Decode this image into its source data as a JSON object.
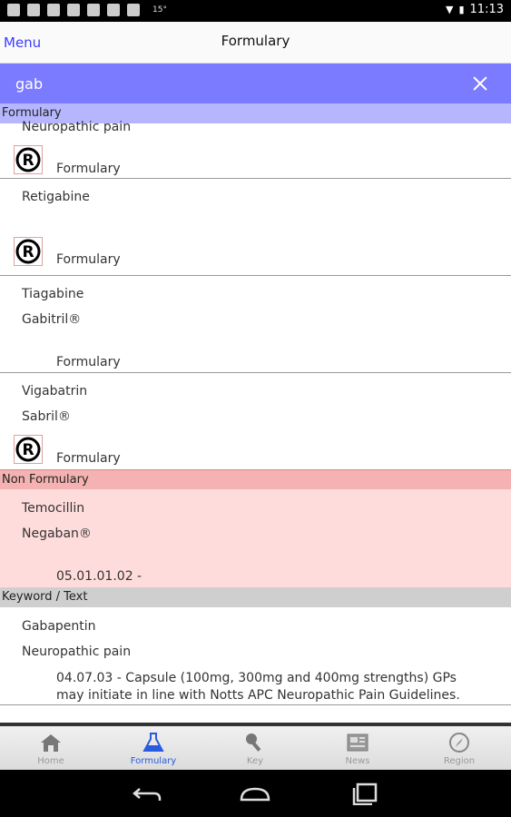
{
  "status_bar": {
    "temperature": "15°",
    "time": "11:13"
  },
  "action_bar": {
    "menu_label": "Menu",
    "title": "Formulary"
  },
  "search": {
    "value": "gab"
  },
  "sections": {
    "formulary": "Formulary",
    "non_formulary": "Non Formulary",
    "keyword": "Keyword / Text"
  },
  "items": [
    {
      "line2": "Neuropathic pain",
      "status": "Formulary"
    },
    {
      "name": "Retigabine",
      "status": "Formulary"
    },
    {
      "name": "Tiagabine",
      "brand": "Gabitril®",
      "status": "Formulary"
    },
    {
      "name": "Vigabatrin",
      "brand": "Sabril®",
      "status": "Formulary"
    },
    {
      "name": "Temocillin",
      "brand": "Negaban®",
      "status": "05.01.01.02 -"
    },
    {
      "name": "Gabapentin",
      "brand": "Neuropathic pain",
      "status": "04.07.03 - Capsule (100mg, 300mg and 400mg strengths) GPs may initiate in line with Notts APC Neuropathic Pain Guidelines."
    }
  ],
  "nav": [
    {
      "label": "Home",
      "icon": "home-icon"
    },
    {
      "label": "Formulary",
      "icon": "flask-icon"
    },
    {
      "label": "Key",
      "icon": "key-icon"
    },
    {
      "label": "News",
      "icon": "news-icon"
    },
    {
      "label": "Region",
      "icon": "compass-icon"
    }
  ],
  "colors": {
    "search_bar": "#7b7bff",
    "formulary_header": "#b6b6ff",
    "non_formulary_header": "#f4b2b2",
    "non_formulary_bg": "#ffdcdc",
    "keyword_header": "#cfcfcf",
    "active_nav": "#2a5adf"
  }
}
